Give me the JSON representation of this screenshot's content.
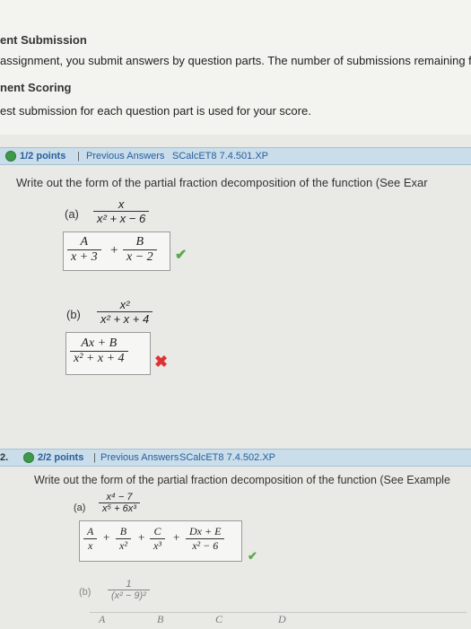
{
  "submission": {
    "heading": "ent Submission",
    "text": "assignment, you submit answers by question parts. The number of submissions remaining f",
    "scoring_heading": "nent Scoring",
    "scoring_text": "est submission for each question part is used for your score."
  },
  "q1": {
    "points": "1/2 points",
    "separator": "|",
    "prev_answers": "Previous Answers",
    "source": "SCalcET8 7.4.501.XP",
    "prompt": "Write out the form of the partial fraction decomposition of the function (See Exar",
    "part_a": {
      "label": "(a)",
      "num": "x",
      "den": "x² + x − 6",
      "answer": [
        {
          "num": "A",
          "den": "x + 3"
        },
        {
          "op": "+"
        },
        {
          "num": "B",
          "den": "x − 2"
        }
      ],
      "status": "correct"
    },
    "part_b": {
      "label": "(b)",
      "num": "x²",
      "den": "x² + x + 4",
      "answer_num": "Ax + B",
      "answer_den": "x² + x + 4",
      "status": "incorrect"
    }
  },
  "q2": {
    "number": "2.",
    "points": "2/2 points",
    "separator": "|",
    "prev_answers": "Previous Answers",
    "source": "SCalcET8 7.4.502.XP",
    "prompt": "Write out the form of the partial fraction decomposition of the function (See Example",
    "part_a": {
      "label": "(a)",
      "num": "x⁴ − 7",
      "den": "x⁵ + 6x³",
      "terms": [
        {
          "num": "A",
          "den": "x"
        },
        {
          "num": "B",
          "den": "x²"
        },
        {
          "num": "C",
          "den": "x³"
        },
        {
          "num": "Dx + E",
          "den": "x² − 6"
        }
      ],
      "ops": [
        "+",
        "+",
        "+"
      ]
    },
    "part_b": {
      "label": "(b)",
      "num": "1",
      "den": "(x² − 9)²",
      "partial_terms": [
        "A",
        "B",
        "C",
        "D"
      ]
    }
  }
}
